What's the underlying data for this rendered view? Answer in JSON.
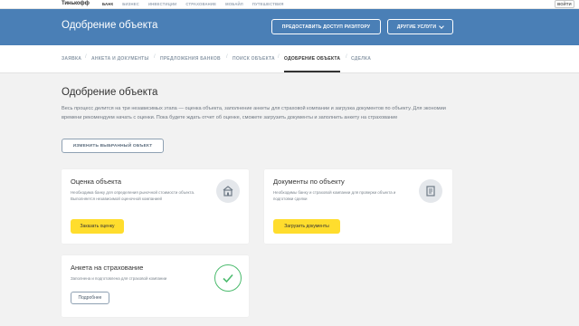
{
  "topbar": {
    "brand": "Тинькофф",
    "nav": [
      "БАНК",
      "БИЗНЕС",
      "ИНВЕСТИЦИИ",
      "СТРАХОВАНИЕ",
      "МОБАЙЛ",
      "ПУТЕШЕСТВИЯ"
    ],
    "login": "ВОЙТИ"
  },
  "header": {
    "title": "Одобрение объекта",
    "realtor_button": "ПРЕДОСТАВИТЬ ДОСТУП РИЭЛТОРУ",
    "services_button": "ДРУГИЕ УСЛУГИ"
  },
  "tabs": [
    "ЗАЯВКА",
    "АНКЕТА И ДОКУМЕНТЫ",
    "ПРЕДЛОЖЕНИЯ БАНКОВ",
    "ПОИСК ОБЪЕКТА",
    "ОДОБРЕНИЕ ОБЪЕКТА",
    "СДЕЛКА"
  ],
  "main": {
    "title": "Одобрение объекта",
    "lead": "Весь процесс делится на три независимых этапа — оценка объекта, заполнение анкеты для страховой компании и загрузка документов по объекту. Для экономии времени рекомендуем начать с оценки. Пока будете ждать отчет об оценке, сможете загрузить документы и заполнить анкету на страхование",
    "change_button": "ИЗМЕНИТЬ ВЫБРАННЫЙ ОБЪЕКТ"
  },
  "cards": {
    "valuation": {
      "title": "Оценка объекта",
      "text": "Необходима банку для определения рыночной стоимости объекта. Выполняется независимой оценочной компанией",
      "button": "Заказать оценку",
      "icon": "house-icon"
    },
    "documents": {
      "title": "Документы по объекту",
      "text": "Необходимы банку и страховой компании для проверки объекта и подготовки сделки",
      "button": "Загрузить документы",
      "icon": "document-icon"
    },
    "insurance": {
      "title": "Анкета на страхование",
      "text": "Заполнена и подготовлена для страховой компании",
      "button": "Подробнее",
      "icon": "checkmark-icon",
      "status_color": "#4cbb6e"
    }
  },
  "colors": {
    "header_bg": "#4a7fb6",
    "accent_yellow": "#ffdd2d",
    "success_green": "#4cbb6e"
  }
}
